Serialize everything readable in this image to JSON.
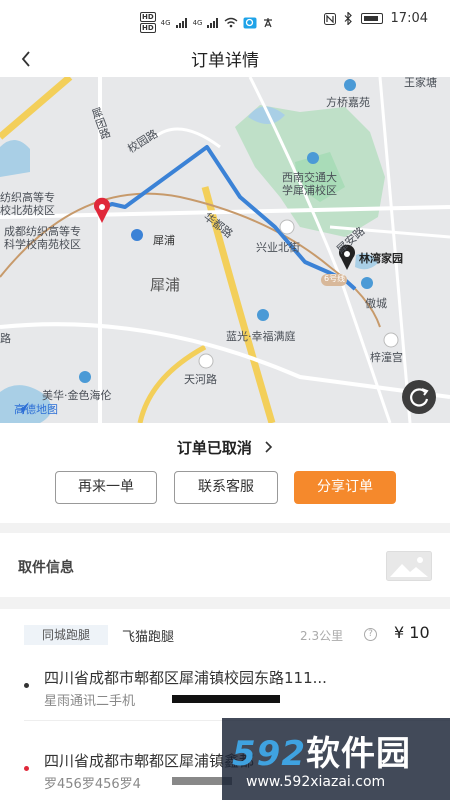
{
  "status_bar": {
    "time": "17:04",
    "sim1": "HD",
    "sim2": "HD",
    "net1": "4G",
    "net2": "4G"
  },
  "header": {
    "title": "订单详情",
    "back_icon": "chevron-left-icon"
  },
  "map": {
    "labels": {
      "topright_cut": "王家塘",
      "fangqiao": "方桥嘉苑",
      "xuefu": "犀团路",
      "xiaoyuan": "校园路",
      "jiaoda1": "西南交通大",
      "jiaoda2": "学犀浦校区",
      "fangzhi1a": "纺织高等专",
      "fangzhi1b": "校北苑校区",
      "fangzhi2a": "成都纺织高等专",
      "fangzhi2b": "科学校南苑校区",
      "xipu_station": "犀浦",
      "huadu": "华都路",
      "xingye": "兴业北街",
      "xian": "犀安路",
      "linwan": "林湾家园",
      "no6": "6号线",
      "aocheng": "傲城",
      "xipu_area": "犀浦",
      "languang": "蓝光·幸福满庭",
      "zitong": "梓潼宫",
      "tianhe": "天河路",
      "meihua": "美华·金色海伦",
      "left_road": "路",
      "logo": "高德地图"
    },
    "refresh_icon": "refresh-icon",
    "route_color": "#3b82d6"
  },
  "order": {
    "status": "订单已取消",
    "buttons": {
      "reorder": "再来一单",
      "contact": "联系客服",
      "share": "分享订单"
    },
    "accent_color": "#f5892c"
  },
  "pickup": {
    "title": "取件信息",
    "photo_icon": "image-placeholder-icon"
  },
  "detail": {
    "service_tag": "同城跑腿",
    "service_name": "飞猫跑腿",
    "distance": "2.3公里",
    "price": "¥ 10",
    "from": {
      "address": "四川省成都市郫都区犀浦镇校园东路111...",
      "contact": "星雨通讯二手机"
    },
    "to": {
      "address": "四川省成都市郫都区犀浦镇鑫都",
      "contact": "罗456罗456罗4"
    }
  },
  "watermark": {
    "brand_num": "592",
    "brand_text": "软件园",
    "url": "www.592xiazai.com"
  }
}
